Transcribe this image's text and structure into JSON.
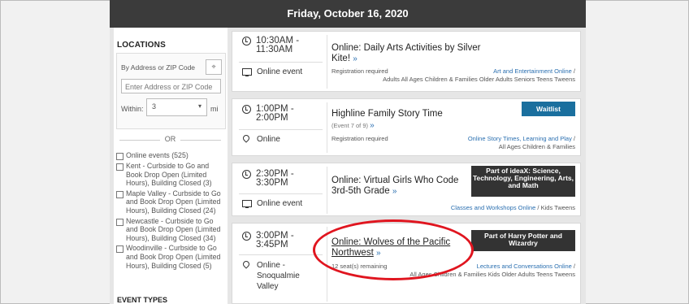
{
  "day_header": "Friday, October 16, 2020",
  "sidebar": {
    "locations_title": "LOCATIONS",
    "by_address_label": "By Address or ZIP Code",
    "zip_placeholder": "Enter Address or ZIP Code",
    "within_label": "Within:",
    "within_value": "3",
    "mi_label": "mi",
    "or_label": "OR",
    "locations": [
      "Online events (525)",
      "Kent - Curbside to Go and Book Drop Open (Limited Hours), Building Closed (3)",
      "Maple Valley - Curbside to Go and Book Drop Open (Limited Hours), Building Closed (24)",
      "Newcastle - Curbside to Go and Book Drop Open (Limited Hours), Building Closed (34)",
      "Woodinville - Curbside to Go and Book Drop Open (Limited Hours), Building Closed (5)"
    ],
    "event_types_title": "EVENT TYPES"
  },
  "events": [
    {
      "time_start": "10:30AM -",
      "time_end": "11:30AM",
      "location": "Online event",
      "title": "Online: Daily Arts Activities by Silver Kite!",
      "more": "»",
      "registration": "Registration required",
      "category_link": "Art and Entertainment Online",
      "audiences": "Adults All Ages Children & Families Older Adults Seniors Teens Tweens"
    },
    {
      "time_start": "1:00PM -",
      "time_end": "2:00PM",
      "location": "Online",
      "title": "Highline Family Story Time",
      "subtitle": "(Event 7 of 9)",
      "more": "»",
      "badge": "Waitlist",
      "registration": "Registration required",
      "category_link": "Online Story Times, Learning and Play",
      "audiences": "All Ages Children & Families"
    },
    {
      "time_start": "2:30PM -",
      "time_end": "3:30PM",
      "location": "Online event",
      "title": "Online: Virtual Girls Who Code 3rd-5th Grade",
      "more": "»",
      "badge": "Part of ideaX: Science, Technology, Engineering, Arts, and Math",
      "category_link": "Classes and Workshops Online",
      "audiences": "Kids Tweens"
    },
    {
      "time_start": "3:00PM -",
      "time_end": "3:45PM",
      "location": "Online - Snoqualmie Valley",
      "title": "Online: Wolves of the Pacific Northwest",
      "more": "»",
      "badge": "Part of Harry Potter and Wizardry",
      "registration": "12 seat(s) remaining",
      "category_link": "Lectures and Conversations Online",
      "audiences": "All Ages Children & Families Kids Older Adults Teens Tweens"
    }
  ],
  "colors": {
    "header_bg": "#3b3b3b",
    "link": "#2a6fb0",
    "waitlist_badge": "#1a6f9e",
    "annotation": "#e0151f"
  }
}
